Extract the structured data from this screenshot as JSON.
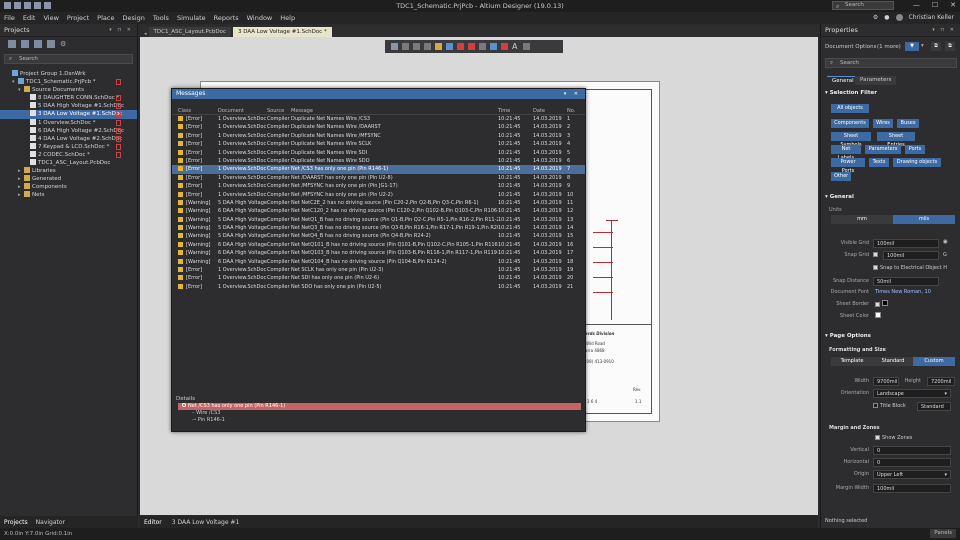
{
  "titlebar": {
    "title": "TDC1_Schematic.PrjPcb - Altium Designer (19.0.13)",
    "search_placeholder": "Search",
    "minimize": "—",
    "maximize": "☐",
    "close": "✕"
  },
  "menu": {
    "items": [
      "File",
      "Edit",
      "View",
      "Project",
      "Place",
      "Design",
      "Tools",
      "Simulate",
      "Reports",
      "Window",
      "Help"
    ],
    "user_name": "Christian Keller"
  },
  "projects_panel": {
    "title": "Projects",
    "search_placeholder": "Search",
    "tree": [
      {
        "label": "Project Group 1.DsnWrk",
        "indent": 0,
        "icon": "proj",
        "arrow": ""
      },
      {
        "label": "TDC1_Schematic.PrjPcb *",
        "indent": 1,
        "icon": "proj",
        "arrow": "▾",
        "flag": true
      },
      {
        "label": "Source Documents",
        "indent": 2,
        "icon": "fold",
        "arrow": "▾"
      },
      {
        "label": "8 DAUGHTER CONN.SchDoc *",
        "indent": 3,
        "icon": "doc",
        "flag": true
      },
      {
        "label": "5 DAA High Voltage #1.SchDoc",
        "indent": 3,
        "icon": "doc",
        "flag": true
      },
      {
        "label": "3 DAA Low Voltage #1.SchDoc",
        "indent": 3,
        "icon": "doc",
        "flag": true,
        "selected": true
      },
      {
        "label": "1 Overview.SchDoc *",
        "indent": 3,
        "icon": "doc",
        "flag": true
      },
      {
        "label": "6 DAA High Voltage #2.SchDoc",
        "indent": 3,
        "icon": "doc",
        "flag": true
      },
      {
        "label": "4 DAA Low Voltage #2.SchDoc",
        "indent": 3,
        "icon": "doc",
        "flag": true
      },
      {
        "label": "7 Keypad & LCD.SchDoc *",
        "indent": 3,
        "icon": "doc",
        "flag": true
      },
      {
        "label": "2 CODEC.SchDoc *",
        "indent": 3,
        "icon": "doc",
        "flag": true
      },
      {
        "label": "TDC1_ASC_Layout.PcbDoc",
        "indent": 3,
        "icon": "doc"
      },
      {
        "label": "Libraries",
        "indent": 2,
        "icon": "fold",
        "arrow": "▸"
      },
      {
        "label": "Generated",
        "indent": 2,
        "icon": "fold",
        "arrow": "▸"
      },
      {
        "label": "Components",
        "indent": 2,
        "icon": "fold",
        "arrow": "▸"
      },
      {
        "label": "Nets",
        "indent": 2,
        "icon": "fold",
        "arrow": "▸"
      }
    ],
    "bottom_tabs": [
      "Projects",
      "Navigator"
    ]
  },
  "doc_tabs": [
    {
      "label": "TDC1_ASC_Layout.PcbDoc",
      "active": false
    },
    {
      "label": "3 DAA Low Voltage #1.SchDoc *",
      "active": true
    }
  ],
  "editor_tabs": [
    "Editor",
    "3 DAA Low Voltage #1"
  ],
  "sheet": {
    "title_lines": [
      "ards Division",
      "Wild Road",
      "arra 4868",
      "(08) 413-0910"
    ],
    "rev_label": "Rev.",
    "rev_value": "1.1",
    "sheet_of": "3   6   4"
  },
  "messages": {
    "title": "Messages",
    "columns": [
      "Class",
      "Document",
      "Source",
      "Message",
      "Time",
      "Date",
      "No."
    ],
    "rows": [
      {
        "class": "[Error]",
        "doc": "1 Overview.SchDoc",
        "src": "Compiler",
        "msg": "Duplicate Net Names Wire /CS3",
        "time": "10:21:45",
        "date": "14.03.2019",
        "no": "1"
      },
      {
        "class": "[Error]",
        "doc": "1 Overview.SchDoc",
        "src": "Compiler",
        "msg": "Duplicate Net Names Wire /DAARST",
        "time": "10:21:45",
        "date": "14.03.2019",
        "no": "2"
      },
      {
        "class": "[Error]",
        "doc": "1 Overview.SchDoc",
        "src": "Compiler",
        "msg": "Duplicate Net Names Wire /MFSYNC",
        "time": "10:21:45",
        "date": "14.03.2019",
        "no": "3"
      },
      {
        "class": "[Error]",
        "doc": "1 Overview.SchDoc",
        "src": "Compiler",
        "msg": "Duplicate Net Names Wire SCLK",
        "time": "10:21:45",
        "date": "14.03.2019",
        "no": "4"
      },
      {
        "class": "[Error]",
        "doc": "1 Overview.SchDoc",
        "src": "Compiler",
        "msg": "Duplicate Net Names Wire SDI",
        "time": "10:21:45",
        "date": "14.03.2019",
        "no": "5"
      },
      {
        "class": "[Error]",
        "doc": "1 Overview.SchDoc",
        "src": "Compiler",
        "msg": "Duplicate Net Names Wire SDO",
        "time": "10:21:45",
        "date": "14.03.2019",
        "no": "6"
      },
      {
        "class": "[Error]",
        "doc": "1 Overview.SchDoc",
        "src": "Compiler",
        "msg": "Net /CS3 has only one pin (Pin R146-1)",
        "time": "10:21:45",
        "date": "14.03.2019",
        "no": "7",
        "selected": true
      },
      {
        "class": "[Error]",
        "doc": "1 Overview.SchDoc",
        "src": "Compiler",
        "msg": "Net /DAARST has only one pin (Pin U2-8)",
        "time": "10:21:45",
        "date": "14.03.2019",
        "no": "8"
      },
      {
        "class": "[Error]",
        "doc": "1 Overview.SchDoc",
        "src": "Compiler",
        "msg": "Net /MFSYNC has only one pin (Pin JG1-17)",
        "time": "10:21:45",
        "date": "14.03.2019",
        "no": "9"
      },
      {
        "class": "[Error]",
        "doc": "1 Overview.SchDoc",
        "src": "Compiler",
        "msg": "Net /MFSYNC has only one pin (Pin U2-2)",
        "time": "10:21:45",
        "date": "14.03.2019",
        "no": "10"
      },
      {
        "class": "[Warning]",
        "doc": "5 DAA High Voltage",
        "src": "Compiler",
        "msg": "Net NetC2E_2 has no driving source (Pin C20-2,Pin Q2-B,Pin Q3-C,Pin R6-1)",
        "time": "10:21:45",
        "date": "14.03.2019",
        "no": "11"
      },
      {
        "class": "[Warning]",
        "doc": "6 DAA High Voltage",
        "src": "Compiler",
        "msg": "Net NetC120_2 has no driving source (Pin C120-2,Pin Q102-B,Pin Q103-C,Pin R106-1)",
        "time": "10:21:45",
        "date": "14.03.2019",
        "no": "12"
      },
      {
        "class": "[Warning]",
        "doc": "5 DAA High Voltage",
        "src": "Compiler",
        "msg": "Net NetQ1_B has no driving source (Pin Q1-B,Pin Q2-C,Pin R5-1,Pin R16-2,Pin R11-2)",
        "time": "10:21:45",
        "date": "14.03.2019",
        "no": "13"
      },
      {
        "class": "[Warning]",
        "doc": "5 DAA High Voltage",
        "src": "Compiler",
        "msg": "Net NetQ3_B has no driving source (Pin Q3-B,Pin R16-1,Pin R17-1,Pin R19-1,Pin R20-1)",
        "time": "10:21:45",
        "date": "14.03.2019",
        "no": "14"
      },
      {
        "class": "[Warning]",
        "doc": "5 DAA High Voltage",
        "src": "Compiler",
        "msg": "Net NetQ4_B has no driving source (Pin Q4-B,Pin R24-2)",
        "time": "10:21:45",
        "date": "14.03.2019",
        "no": "15"
      },
      {
        "class": "[Warning]",
        "doc": "6 DAA High Voltage",
        "src": "Compiler",
        "msg": "Net NetQ101_B has no driving source (Pin Q101-B,Pin Q102-C,Pin R105-1,Pin R116-2)",
        "time": "10:21:45",
        "date": "14.03.2019",
        "no": "16"
      },
      {
        "class": "[Warning]",
        "doc": "6 DAA High Voltage",
        "src": "Compiler",
        "msg": "Net NetQ103_B has no driving source (Pin Q103-B,Pin R116-1,Pin R117-1,Pin R119-1)",
        "time": "10:21:45",
        "date": "14.03.2019",
        "no": "17"
      },
      {
        "class": "[Warning]",
        "doc": "6 DAA High Voltage",
        "src": "Compiler",
        "msg": "Net NetQ104_B has no driving source (Pin Q104-B,Pin R124-2)",
        "time": "10:21:45",
        "date": "14.03.2019",
        "no": "18"
      },
      {
        "class": "[Error]",
        "doc": "1 Overview.SchDoc",
        "src": "Compiler",
        "msg": "Net SCLK has only one pin (Pin U2-3)",
        "time": "10:21:45",
        "date": "14.03.2019",
        "no": "19"
      },
      {
        "class": "[Error]",
        "doc": "1 Overview.SchDoc",
        "src": "Compiler",
        "msg": "Net SDI has only one pin (Pin U2-6)",
        "time": "10:21:45",
        "date": "14.03.2019",
        "no": "20"
      },
      {
        "class": "[Error]",
        "doc": "1 Overview.SchDoc",
        "src": "Compiler",
        "msg": "Net SDO has only one pin (Pin U2-5)",
        "time": "10:21:45",
        "date": "14.03.2019",
        "no": "21"
      }
    ],
    "details": {
      "label": "Details",
      "main": "Net /CS3 has only one pin (Pin R146-1)",
      "sub": [
        "Wire /CS3",
        "Pin R146-1"
      ]
    }
  },
  "properties": {
    "title": "Properties",
    "doc_options": "Document Options",
    "more": "(1 more)",
    "search_placeholder": "Search",
    "tabs": [
      "General",
      "Parameters"
    ],
    "selection_filter": "Selection Filter",
    "all_objects": "All objects",
    "filters": [
      "Components",
      "Wires",
      "Buses",
      "Sheet Symbols",
      "Sheet Entries",
      "Net Labels",
      "Parameters",
      "Ports",
      "Power Ports",
      "Texts",
      "Drawing objects",
      "Other"
    ],
    "general": "General",
    "units_label": "Units",
    "units": [
      "mm",
      "mils"
    ],
    "visible_grid_label": "Visible Grid",
    "visible_grid": "100mil",
    "snap_grid_label": "Snap Grid",
    "snap_grid": "100mil",
    "snap_grid_key": "G",
    "snap_electrical": "Snap to Electrical Object H",
    "snap_distance_label": "Snap Distance",
    "snap_distance": "50mil",
    "doc_font_label": "Document Font",
    "doc_font": "Times New Roman, 10",
    "sheet_border_label": "Sheet Border",
    "sheet_color_label": "Sheet Color",
    "page_options": "Page Options",
    "formatting": "Formatting and Size",
    "format_tabs": [
      "Template",
      "Standard",
      "Custom"
    ],
    "width_label": "Width",
    "width": "9700mil",
    "height_label": "Height",
    "height": "7200mil",
    "orientation_label": "Orientation",
    "orientation": "Landscape",
    "title_block": "Title Block",
    "title_block_value": "Standard",
    "margin_zones": "Margin and Zones",
    "show_zones": "Show Zones",
    "vertical_label": "Vertical",
    "vertical": "0",
    "horizontal_label": "Horizontal",
    "horizontal": "0",
    "origin_label": "Origin",
    "origin": "Upper Left",
    "margin_width_label": "Margin Width",
    "margin_width": "100mil",
    "status": "Nothing selected"
  },
  "statusbar": {
    "coords": "X:0.0in Y:7.0in    Grid:0.1in",
    "panels": "Panels"
  },
  "colors": {
    "accent": "#3e6aa3",
    "error_row": "#c76363",
    "warning": "#e3b53a"
  }
}
